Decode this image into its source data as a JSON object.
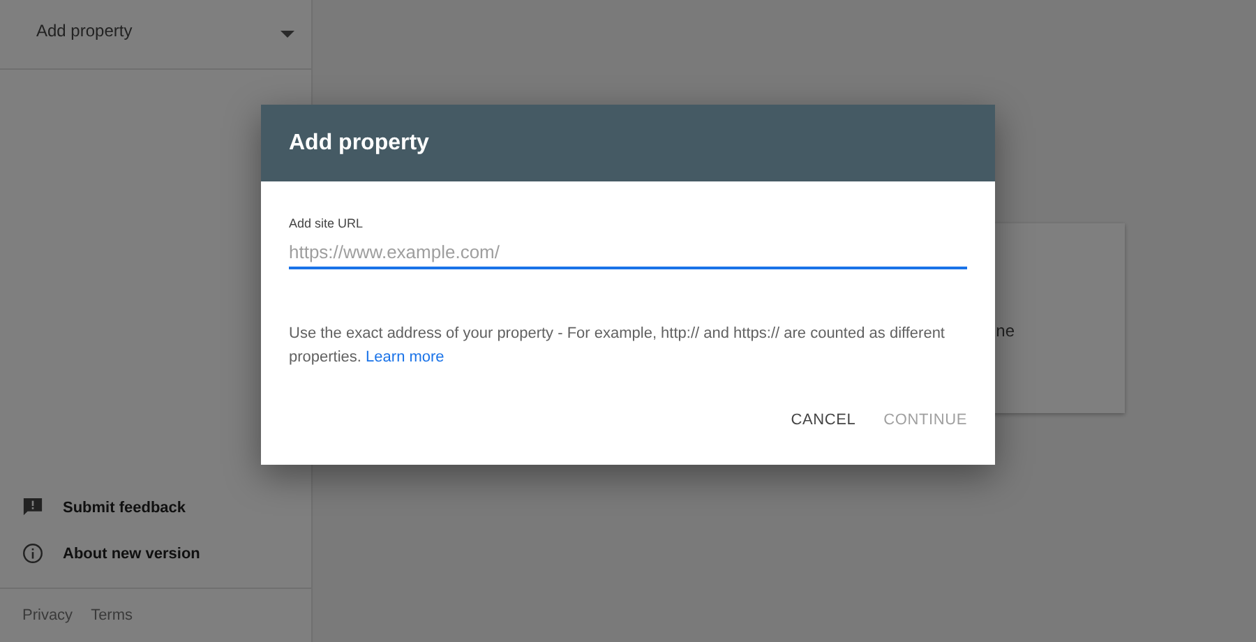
{
  "sidebar": {
    "property_selector": {
      "label": "Add property"
    },
    "items": [
      {
        "kind": "feedback",
        "label": "Submit feedback"
      },
      {
        "kind": "info",
        "label": "About new version"
      }
    ],
    "footer_links": [
      "Privacy",
      "Terms"
    ]
  },
  "background_card": {
    "text": "ne"
  },
  "dialog": {
    "title": "Add property",
    "field": {
      "label": "Add site URL",
      "placeholder": "https://www.example.com/",
      "focused": true
    },
    "help_text": "Use the exact address of your property - For example, http:// and https:// are counted as different properties.",
    "help_link": "Learn more",
    "buttons": [
      {
        "label": "CANCEL",
        "disabled": false
      },
      {
        "label": "CONTINUE",
        "disabled": true
      }
    ]
  }
}
